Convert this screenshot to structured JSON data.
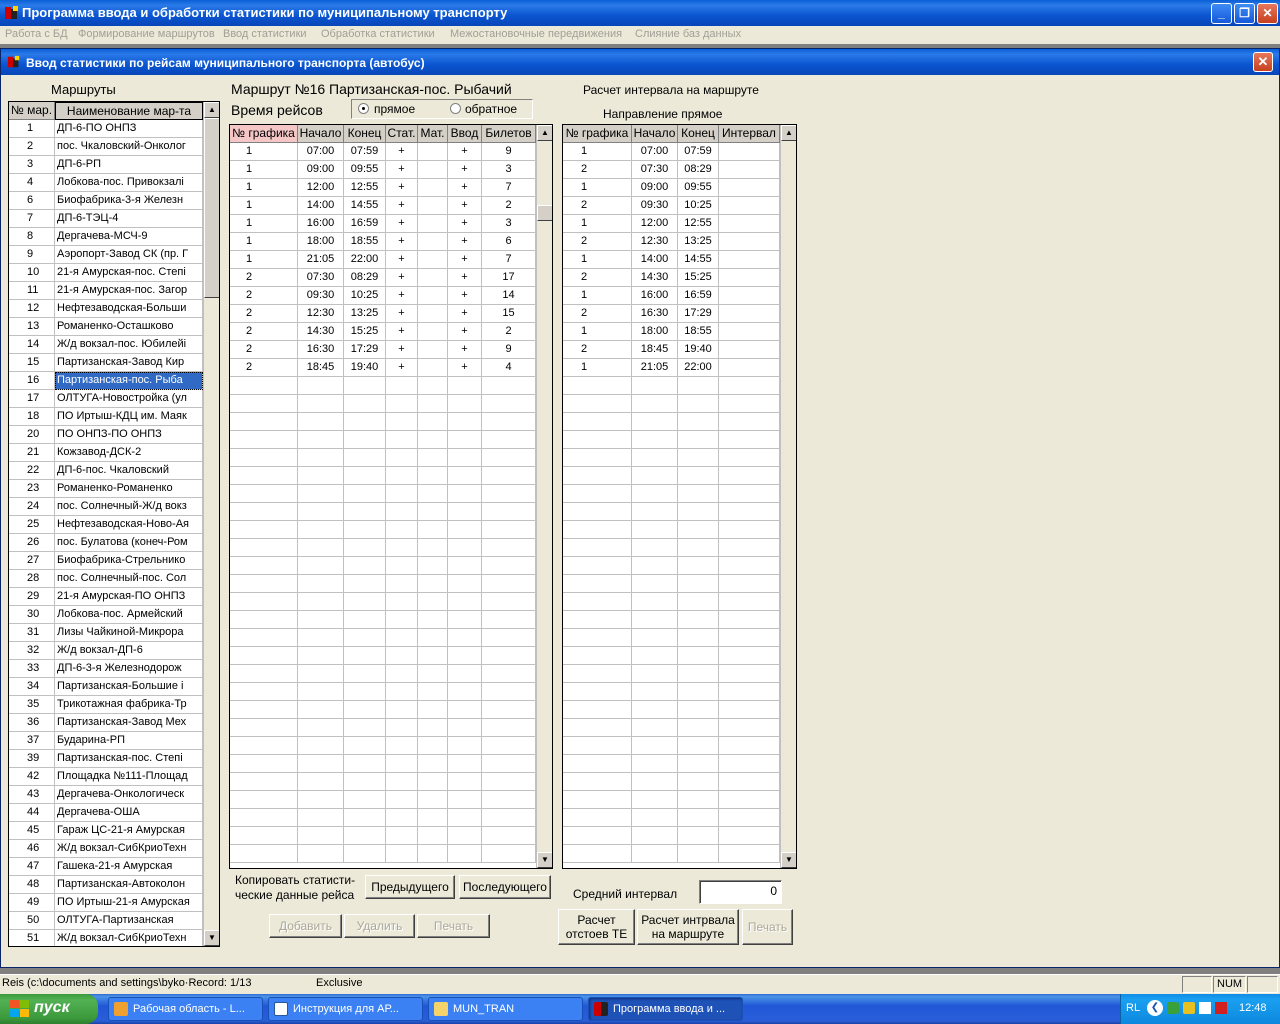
{
  "app": {
    "title": "Программа ввода и обработки статистики по муниципальному транспорту",
    "menu": [
      "Работа с БД",
      "Формирование маршрутов",
      "Ввод статистики",
      "Обработка статистики",
      "Межостановочные передвижения",
      "Слияние баз данных"
    ]
  },
  "child": {
    "title": "Ввод статистики по рейсам муниципального транспорта (автобус)"
  },
  "routes": {
    "label": "Маршруты",
    "col_num": "№ мар.",
    "col_name": "Наименование мар-та",
    "selected_num": "16",
    "items": [
      [
        "1",
        "ДП-6-ПО ОНПЗ"
      ],
      [
        "2",
        "пос. Чкаловский-Онколог"
      ],
      [
        "3",
        "ДП-6-РП"
      ],
      [
        "4",
        "Лобкова-пос. Привокзалі"
      ],
      [
        "6",
        "Биофабрика-3-я Железн"
      ],
      [
        "7",
        "ДП-6-ТЭЦ-4"
      ],
      [
        "8",
        "Дергачева-МСЧ-9"
      ],
      [
        "9",
        "Аэропорт-Завод СК (пр. Г"
      ],
      [
        "10",
        "21-я Амурская-пос. Степі"
      ],
      [
        "11",
        "21-я Амурская-пос. Загор"
      ],
      [
        "12",
        "Нефтезаводская-Больши"
      ],
      [
        "13",
        "Романенко-Осташково"
      ],
      [
        "14",
        "Ж/д вокзал-пос. Юбилейі"
      ],
      [
        "15",
        "Партизанская-Завод Кир"
      ],
      [
        "16",
        "Партизанская-пос. Рыба"
      ],
      [
        "17",
        "ОЛТУГА-Новостройка (ул"
      ],
      [
        "18",
        "ПО Иртыш-КДЦ им. Маяк"
      ],
      [
        "20",
        "ПО ОНПЗ-ПО ОНПЗ"
      ],
      [
        "21",
        "Кожзавод-ДСК-2"
      ],
      [
        "22",
        "ДП-6-пос. Чкаловский"
      ],
      [
        "23",
        "Романенко-Романенко"
      ],
      [
        "24",
        "пос. Солнечный-Ж/д вокз"
      ],
      [
        "25",
        "Нефтезаводская-Ново-Ая"
      ],
      [
        "26",
        "пос. Булатова (конеч-Ром"
      ],
      [
        "27",
        "Биофабрика-Стрельнико"
      ],
      [
        "28",
        "пос. Солнечный-пос. Сол"
      ],
      [
        "29",
        "21-я Амурская-ПО ОНПЗ"
      ],
      [
        "30",
        "Лобкова-пос. Армейский"
      ],
      [
        "31",
        "Лизы Чайкиной-Микрора"
      ],
      [
        "32",
        "Ж/д вокзал-ДП-6"
      ],
      [
        "33",
        "ДП-6-3-я Железнодорож"
      ],
      [
        "34",
        "Партизанская-Большие і"
      ],
      [
        "35",
        "Трикотажная фабрика-Тр"
      ],
      [
        "36",
        "Партизанская-Завод Мех"
      ],
      [
        "37",
        "Бударина-РП"
      ],
      [
        "39",
        "Партизанская-пос. Степі"
      ],
      [
        "42",
        "Площадка №111-Площад"
      ],
      [
        "43",
        "Дергачева-Онкологическ"
      ],
      [
        "44",
        "Дергачева-ОША"
      ],
      [
        "45",
        "Гараж ЦС-21-я Амурская"
      ],
      [
        "46",
        "Ж/д вокзал-СибКриоТехн"
      ],
      [
        "47",
        "Гашека-21-я Амурская"
      ],
      [
        "48",
        "Партизанская-Автоколон"
      ],
      [
        "49",
        "ПО Иртыш-21-я Амурская"
      ],
      [
        "50",
        "ОЛТУГА-Партизанская"
      ],
      [
        "51",
        "Ж/д вокзал-СибКриоТехн"
      ]
    ]
  },
  "trips": {
    "route_label": "Маршрут №16  Партизанская-пос. Рыбачий",
    "time_label": "Время  рейсов",
    "direction_forward": "прямое",
    "direction_back": "обратное",
    "columns": [
      "№ графика",
      "Начало",
      "Конец",
      "Стат.",
      "Мат.",
      "Ввод",
      "Билетов"
    ],
    "rows": [
      [
        "1",
        "07:00",
        "07:59",
        "+",
        "",
        "+",
        "9"
      ],
      [
        "1",
        "09:00",
        "09:55",
        "+",
        "",
        "+",
        "3"
      ],
      [
        "1",
        "12:00",
        "12:55",
        "+",
        "",
        "+",
        "7"
      ],
      [
        "1",
        "14:00",
        "14:55",
        "+",
        "",
        "+",
        "2"
      ],
      [
        "1",
        "16:00",
        "16:59",
        "+",
        "",
        "+",
        "3"
      ],
      [
        "1",
        "18:00",
        "18:55",
        "+",
        "",
        "+",
        "6"
      ],
      [
        "1",
        "21:05",
        "22:00",
        "+",
        "",
        "+",
        "7"
      ],
      [
        "2",
        "07:30",
        "08:29",
        "+",
        "",
        "+",
        "17"
      ],
      [
        "2",
        "09:30",
        "10:25",
        "+",
        "",
        "+",
        "14"
      ],
      [
        "2",
        "12:30",
        "13:25",
        "+",
        "",
        "+",
        "15"
      ],
      [
        "2",
        "14:30",
        "15:25",
        "+",
        "",
        "+",
        "2"
      ],
      [
        "2",
        "16:30",
        "17:29",
        "+",
        "",
        "+",
        "9"
      ],
      [
        "2",
        "18:45",
        "19:40",
        "+",
        "",
        "+",
        "4"
      ]
    ],
    "copy_label_1": "Копировать статисти-",
    "copy_label_2": "ческие данные рейса",
    "btn_prev": "Предыдущего",
    "btn_next": "Последующего",
    "btn_add": "Добавить",
    "btn_delete": "Удалить",
    "btn_print": "Печать"
  },
  "interval": {
    "title": "Расчет интервала на маршруте",
    "direction": "Направление прямое",
    "columns": [
      "№ графика",
      "Начало",
      "Конец",
      "Интервал"
    ],
    "rows": [
      [
        "1",
        "07:00",
        "07:59",
        ""
      ],
      [
        "2",
        "07:30",
        "08:29",
        ""
      ],
      [
        "1",
        "09:00",
        "09:55",
        ""
      ],
      [
        "2",
        "09:30",
        "10:25",
        ""
      ],
      [
        "1",
        "12:00",
        "12:55",
        ""
      ],
      [
        "2",
        "12:30",
        "13:25",
        ""
      ],
      [
        "1",
        "14:00",
        "14:55",
        ""
      ],
      [
        "2",
        "14:30",
        "15:25",
        ""
      ],
      [
        "1",
        "16:00",
        "16:59",
        ""
      ],
      [
        "2",
        "16:30",
        "17:29",
        ""
      ],
      [
        "1",
        "18:00",
        "18:55",
        ""
      ],
      [
        "2",
        "18:45",
        "19:40",
        ""
      ],
      [
        "1",
        "21:05",
        "22:00",
        ""
      ]
    ],
    "avg_label": "Средний интервал",
    "avg_value": "0",
    "btn_calc_stops_1": "Расчет",
    "btn_calc_stops_2": "отстоев ТЕ",
    "btn_calc_interval_1": "Расчет интрвала",
    "btn_calc_interval_2": "на маршруте",
    "btn_print": "Печать"
  },
  "status": {
    "path": "Reis (c:\\documents and settings\\byko·Record: 1/13",
    "mode": "Exclusive",
    "num": "NUM"
  },
  "taskbar": {
    "start": "пуск",
    "tasks": [
      "Рабочая область - L...",
      "Инструкция для АР...",
      "MUN_TRAN",
      "Программа ввода и ..."
    ],
    "lang": "RL",
    "clock": "12:48"
  }
}
